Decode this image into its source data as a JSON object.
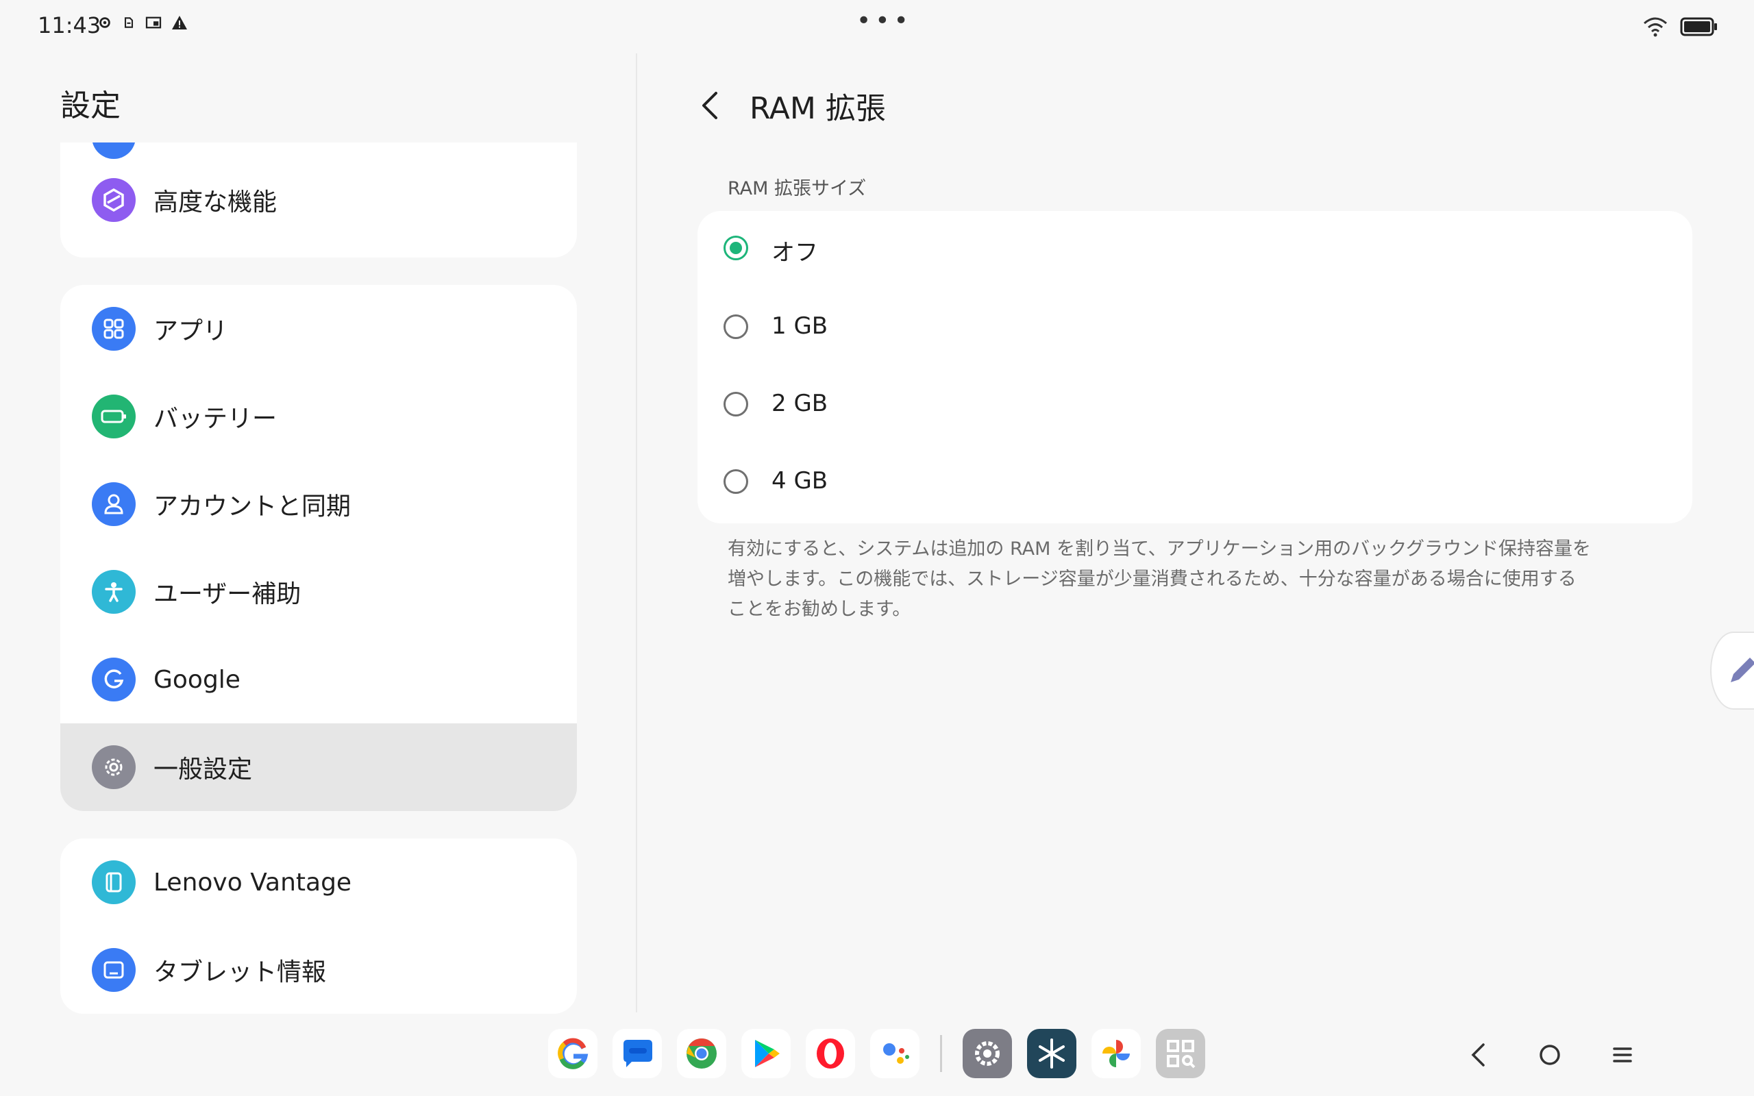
{
  "status": {
    "time": "11:43",
    "left_icons": [
      "settings-gear-icon",
      "sync-icon",
      "cast-icon",
      "warning-icon"
    ],
    "menu_dots": "•••",
    "right_icons": [
      "wifi-icon",
      "battery-icon"
    ]
  },
  "left": {
    "title": "設定",
    "card_top": [
      {
        "label": "高度な機能",
        "icon": "advanced-features-icon",
        "color": "#8e5cf0"
      }
    ],
    "card_mid": [
      {
        "label": "アプリ",
        "icon": "apps-grid-icon",
        "color": "#3a7bf4"
      },
      {
        "label": "バッテリー",
        "icon": "battery-icon",
        "color": "#22b573"
      },
      {
        "label": "アカウントと同期",
        "icon": "account-icon",
        "color": "#3a7bf4"
      },
      {
        "label": "ユーザー補助",
        "icon": "accessibility-icon",
        "color": "#2fb8d6"
      },
      {
        "label": "Google",
        "icon": "google-icon",
        "color": "#3a7bf4"
      },
      {
        "label": "一般設定",
        "icon": "gear-icon",
        "color": "#8a8a95",
        "selected": true
      }
    ],
    "card_bot": [
      {
        "label": "Lenovo Vantage",
        "icon": "lenovo-vantage-icon",
        "color": "#2fb8d6"
      },
      {
        "label": "タブレット情報",
        "icon": "tablet-info-icon",
        "color": "#3a7bf4"
      }
    ]
  },
  "right": {
    "title": "RAM 拡張",
    "section_header": "RAM 拡張サイズ",
    "options": [
      {
        "label": "オフ",
        "checked": true
      },
      {
        "label": "1 GB",
        "checked": false
      },
      {
        "label": "2 GB",
        "checked": false
      },
      {
        "label": "4 GB",
        "checked": false
      }
    ],
    "description_lines": [
      "有効にすると、システムは追加の RAM を割り当て、アプリケーション用のバックグラウンド保持容量を",
      "増やします。この機能では、ストレージ容量が少量消費されるため、十分な容量がある場合に使用する",
      "ことをお勧めします。"
    ]
  },
  "dock": {
    "apps": [
      "google-app",
      "messages-app",
      "chrome-app",
      "play-store-app",
      "opera-app",
      "assistant-app"
    ],
    "pinned": [
      "settings-app",
      "snowflake-app",
      "photos-app",
      "qr-scanner-app"
    ]
  },
  "colors": {
    "accent": "#1db57a",
    "background": "#f7f7f7",
    "card": "#ffffff",
    "selected": "#e6e6e6"
  }
}
